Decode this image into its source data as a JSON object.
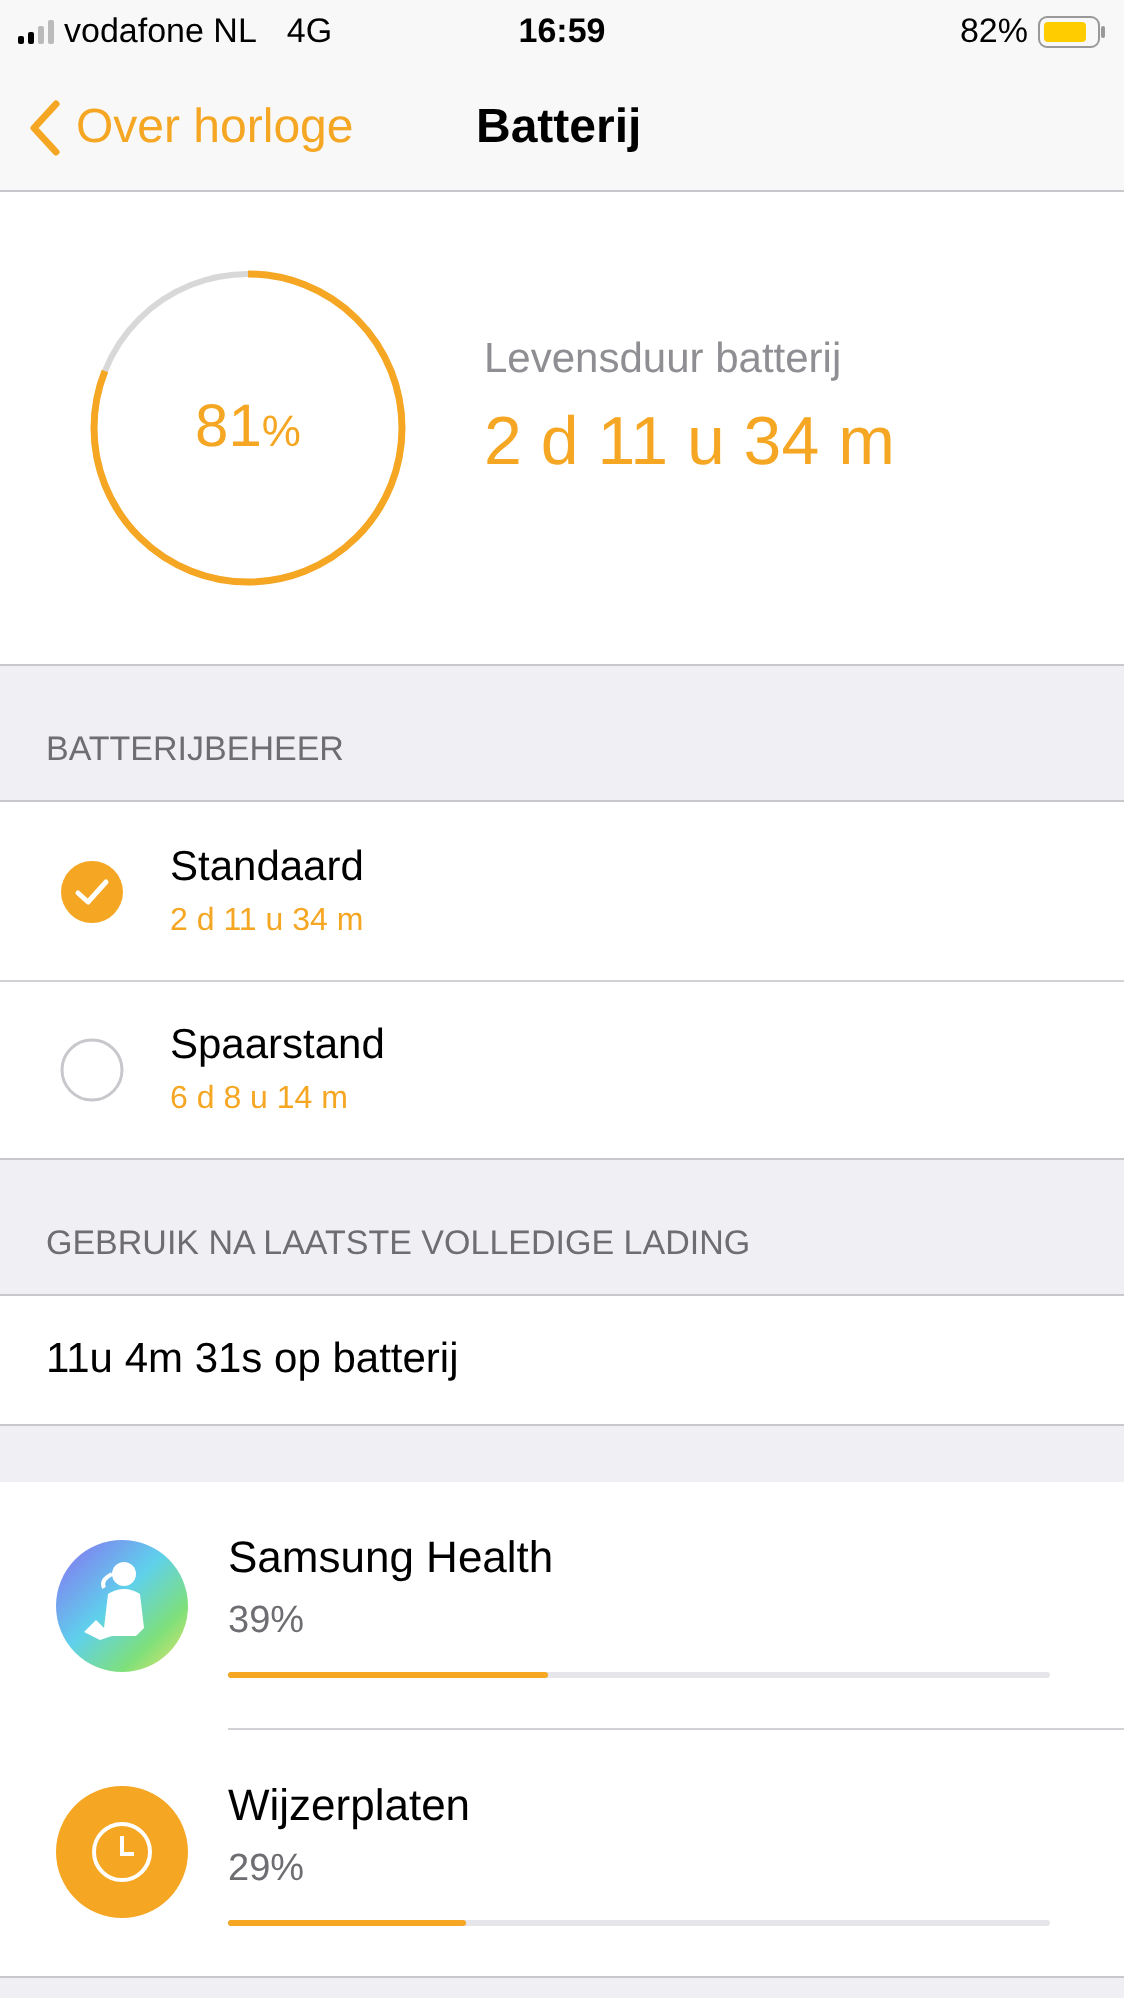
{
  "status_bar": {
    "carrier": "vodafone NL",
    "network": "4G",
    "time": "16:59",
    "battery": "82%"
  },
  "nav": {
    "back": "Over horloge",
    "title": "Batterij"
  },
  "summary": {
    "percent": "81",
    "percent_sign": "%",
    "level": 0.81,
    "label": "Levensduur batterij",
    "remaining": "2 d 11 u 34 m"
  },
  "battery_management": {
    "header": "BATTERIJBEHEER",
    "options": [
      {
        "name": "Standaard",
        "duration": "2 d 11 u 34 m",
        "selected": true
      },
      {
        "name": "Spaarstand",
        "duration": "6 d 8 u 14 m",
        "selected": false
      }
    ]
  },
  "usage": {
    "header": "GEBRUIK NA LAATSTE VOLLEDIGE LADING",
    "total": "11u 4m 31s op batterij",
    "apps": [
      {
        "name": "Samsung Health",
        "kind": "health",
        "reading": "39%",
        "level": 0.39
      },
      {
        "name": "Wijzerplaten",
        "kind": "clock",
        "reading": "29%",
        "level": 0.29
      }
    ]
  }
}
